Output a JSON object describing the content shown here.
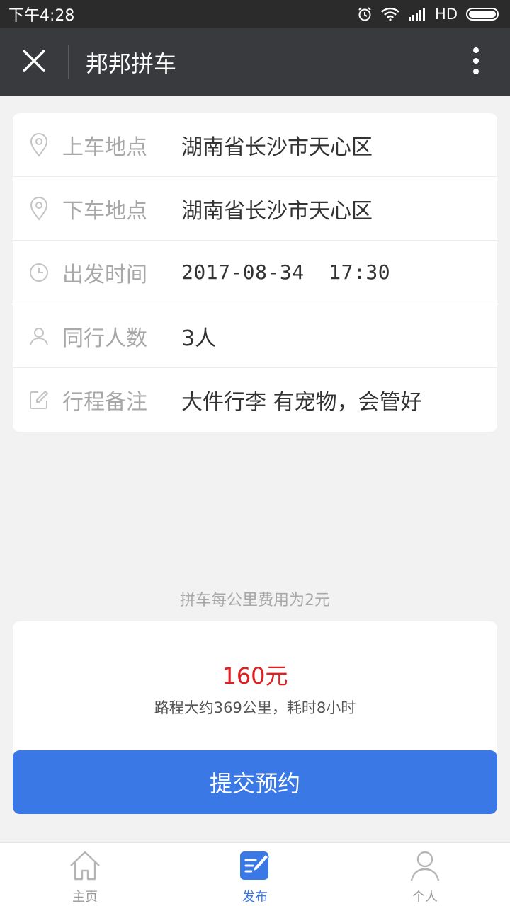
{
  "status_bar": {
    "time": "下午4:28",
    "network": "HD"
  },
  "title_bar": {
    "title": "邦邦拼车",
    "close_icon": "close-icon",
    "more_icon": "more-vertical-icon"
  },
  "form": {
    "rows": [
      {
        "icon": "location-pin-icon",
        "label": "上车地点",
        "value": "湖南省长沙市天心区"
      },
      {
        "icon": "location-pin-icon",
        "label": "下车地点",
        "value": "湖南省长沙市天心区"
      },
      {
        "icon": "clock-icon",
        "label": "出发时间",
        "value": "2017-08-34  17:30"
      },
      {
        "icon": "person-icon",
        "label": "同行人数",
        "value": "3人"
      },
      {
        "icon": "edit-icon",
        "label": "行程备注",
        "value": "大件行李 有宠物，会管好"
      }
    ]
  },
  "fee_hint": "拼车每公里费用为2元",
  "price_card": {
    "price": "160元",
    "route_info": "路程大约369公里，耗时8小时"
  },
  "submit_label": "提交预约",
  "tabs": [
    {
      "label": "主页",
      "icon": "home-icon",
      "active": false
    },
    {
      "label": "发布",
      "icon": "publish-icon",
      "active": true
    },
    {
      "label": "个人",
      "icon": "user-icon",
      "active": false
    }
  ],
  "colors": {
    "accent": "#3a78e6",
    "price": "#e02020",
    "title_bar": "#393a3e",
    "status_bar": "#2b2b2b"
  }
}
